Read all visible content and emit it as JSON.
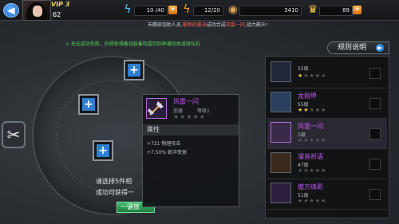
{
  "header": {
    "vip": "VIP 3",
    "level": "62",
    "resources": [
      {
        "icon": "energy-icon",
        "value": "10 /40"
      },
      {
        "icon": "stamina-icon",
        "value": "12/20"
      },
      {
        "icon": "coin-icon",
        "value": "3410"
      },
      {
        "icon": "crown-icon",
        "value": "89"
      }
    ]
  },
  "notice": {
    "pre": "天赐琼羽助人员,",
    "hl1": "暴雨的暴决",
    "mid": "成功合成",
    "hl2": "风雷一闪",
    "post": ",战力飙升!"
  },
  "hint": "× 无论成功失败，仍将获得备战装备和晶饮回神通功血或强化石",
  "rules_label": "规则说明",
  "instructions": {
    "line1": "请选择5件相",
    "line2": "成功可获得一",
    "oneclick_label": "一键放"
  },
  "tooltip": {
    "name": "风雷一闪",
    "type": "武器",
    "level": "等级1",
    "stars": "★★★★★",
    "section": "属性",
    "attrs": [
      "+721 物理攻击",
      "+7.50% 致淬变很"
    ]
  },
  "items": [
    {
      "name": "",
      "level": "55级",
      "stars_on": "★",
      "stars_off": "★★★★",
      "color": "#c35cf0"
    },
    {
      "name": "龙翔甲",
      "level": "55级",
      "stars_on": "★★",
      "stars_off": "★★★",
      "color": "#c35cf0"
    },
    {
      "name": "风雷一闪",
      "level": "1级",
      "stars_on": "",
      "stars_off": "★★★★★",
      "color": "#c35cf0"
    },
    {
      "name": "溜音祈语",
      "level": "47级",
      "stars_on": "",
      "stars_off": "★★★★★",
      "color": "#c35cf0"
    },
    {
      "name": "傲方焕影",
      "level": "51级",
      "stars_on": "",
      "stars_off": "★★★★★",
      "color": "#c35cf0"
    }
  ]
}
